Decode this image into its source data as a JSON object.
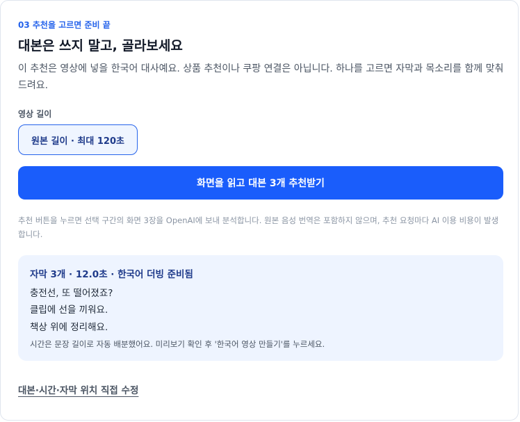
{
  "header": {
    "step_label": "03 추천을 고르면 준비 끝",
    "title": "대본은 쓰지 말고, 골라보세요",
    "description": "이 추천은 영상에 넣을 한국어 대사예요. 상품 추천이나 쿠팡 연결은 아닙니다. 하나를 고르면 자막과 목소리를 함께 맞춰드려요."
  },
  "length": {
    "label": "영상 길이",
    "selected_option": "원본 길이 · 최대 120초"
  },
  "actions": {
    "recommend_button": "화면을 읽고 대본 3개 추천받기",
    "note": "추천 버튼을 누르면 선택 구간의 화면 3장을 OpenAI에 보내 분석합니다. 원본 음성 번역은 포함하지 않으며, 추천 요청마다 AI 이용 비용이 발생합니다.",
    "edit_link": "대본·시간·자막 위치 직접 수정"
  },
  "result": {
    "title": "자막 3개 · 12.0초 · 한국어 더빙 준비됨",
    "lines": [
      "충전선, 또 떨어졌죠?",
      "클립에 선을 끼워요.",
      "책상 위에 정리해요."
    ],
    "note": "시간은 문장 길이로 자동 배분했어요. 미리보기 확인 후 '한국어 영상 만들기'를 누르세요."
  },
  "colors": {
    "accent": "#1a5dfb",
    "step_label": "#2563eb",
    "result_background": "#eef4ff",
    "chip_background": "#eff5ff"
  }
}
